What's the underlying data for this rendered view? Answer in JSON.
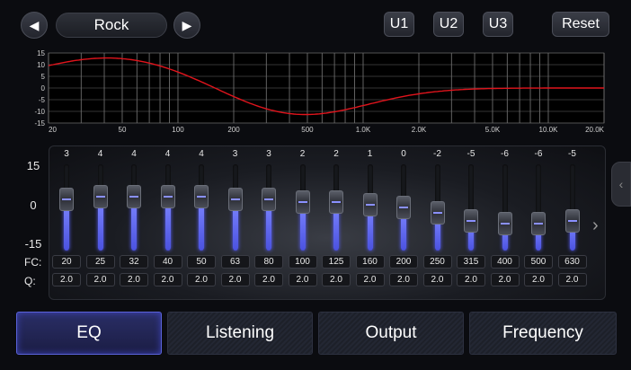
{
  "topbar": {
    "prev_label": "◀",
    "preset": "Rock",
    "next_label": "▶",
    "u1": "U1",
    "u2": "U2",
    "u3": "U3",
    "reset": "Reset"
  },
  "curve": {
    "y_ticks": [
      "15",
      "10",
      "5",
      "0",
      "-5",
      "-10",
      "-15"
    ],
    "x_ticks": [
      "20",
      "50",
      "100",
      "200",
      "500",
      "1.0K",
      "2.0K",
      "5.0K",
      "10.0K",
      "20.0K"
    ],
    "line_color": "#e0141c"
  },
  "sliders": {
    "top_label": "15",
    "mid_label": "0",
    "bottom_label": "-15",
    "fc_label": "FC:",
    "q_label": "Q:",
    "accent": "#6b73ff",
    "bands": [
      {
        "gain": "3",
        "fc": "20",
        "q": "2.0"
      },
      {
        "gain": "4",
        "fc": "25",
        "q": "2.0"
      },
      {
        "gain": "4",
        "fc": "32",
        "q": "2.0"
      },
      {
        "gain": "4",
        "fc": "40",
        "q": "2.0"
      },
      {
        "gain": "4",
        "fc": "50",
        "q": "2.0"
      },
      {
        "gain": "3",
        "fc": "63",
        "q": "2.0"
      },
      {
        "gain": "3",
        "fc": "80",
        "q": "2.0"
      },
      {
        "gain": "2",
        "fc": "100",
        "q": "2.0"
      },
      {
        "gain": "2",
        "fc": "125",
        "q": "2.0"
      },
      {
        "gain": "1",
        "fc": "160",
        "q": "2.0"
      },
      {
        "gain": "0",
        "fc": "200",
        "q": "2.0"
      },
      {
        "gain": "-2",
        "fc": "250",
        "q": "2.0"
      },
      {
        "gain": "-5",
        "fc": "315",
        "q": "2.0"
      },
      {
        "gain": "-6",
        "fc": "400",
        "q": "2.0"
      },
      {
        "gain": "-6",
        "fc": "500",
        "q": "2.0"
      },
      {
        "gain": "-5",
        "fc": "630",
        "q": "2.0"
      }
    ]
  },
  "tabs": [
    {
      "label": "EQ"
    },
    {
      "label": "Listening"
    },
    {
      "label": "Output"
    },
    {
      "label": "Frequency"
    }
  ]
}
